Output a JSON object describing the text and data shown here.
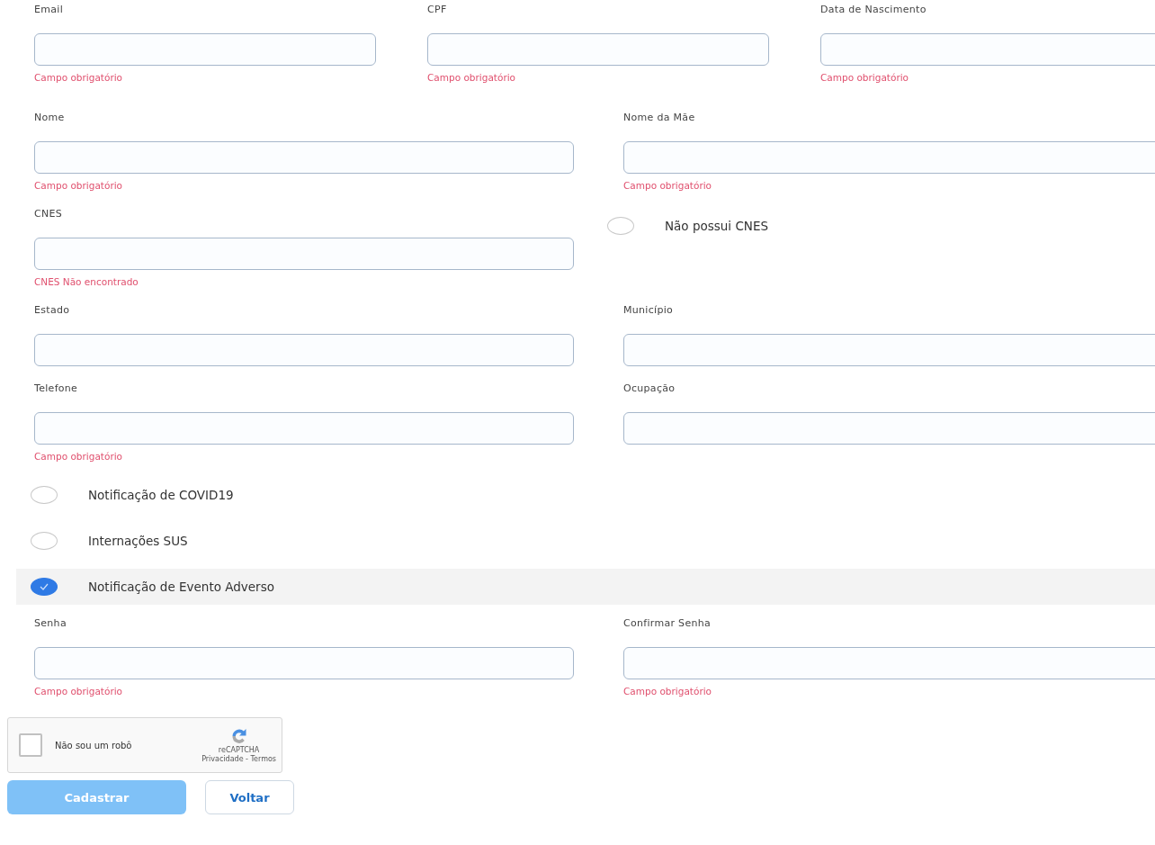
{
  "form_rows": [
    {
      "kind": "fields",
      "fields": [
        {
          "label": "Email",
          "error": "Campo obrigatório"
        },
        {
          "label": "CPF",
          "error": "Campo obrigatório"
        },
        {
          "label": "Data de Nascimento",
          "error": "Campo obrigatório"
        }
      ]
    },
    {
      "kind": "fields",
      "fields": [
        {
          "label": "Nome",
          "error": "Campo obrigatório"
        },
        {
          "label": "Nome da Mãe",
          "error": "Campo obrigatório"
        }
      ]
    },
    {
      "kind": "cnes",
      "fields": [
        {
          "label": "CNES",
          "error": "CNES Não encontrado"
        }
      ],
      "option": {
        "label": "Não possui CNES",
        "checked": false
      }
    },
    {
      "kind": "fields",
      "fields": [
        {
          "label": "Estado"
        },
        {
          "label": "Município"
        }
      ]
    },
    {
      "kind": "fields",
      "fields": [
        {
          "label": "Telefone",
          "error": "Campo obrigatório"
        },
        {
          "label": "Ocupação"
        }
      ]
    }
  ],
  "notifications": [
    {
      "label": "Notificação de COVID19",
      "checked": false
    },
    {
      "label": "Internações SUS",
      "checked": false
    },
    {
      "label": "Notificação de Evento Adverso",
      "checked": true
    }
  ],
  "password_row": {
    "fields": [
      {
        "label": "Senha",
        "error": "Campo obrigatório"
      },
      {
        "label": "Confirmar Senha",
        "error": "Campo obrigatório"
      }
    ]
  },
  "captcha": {
    "label": "Não sou um robô",
    "checked": false,
    "brand": "reCAPTCHA",
    "links": "Privacidade - Termos"
  },
  "buttons": [
    {
      "label": "Cadastrar",
      "kind": "primary",
      "disabled": true
    },
    {
      "label": "Voltar",
      "kind": "secondary",
      "disabled": false
    }
  ]
}
